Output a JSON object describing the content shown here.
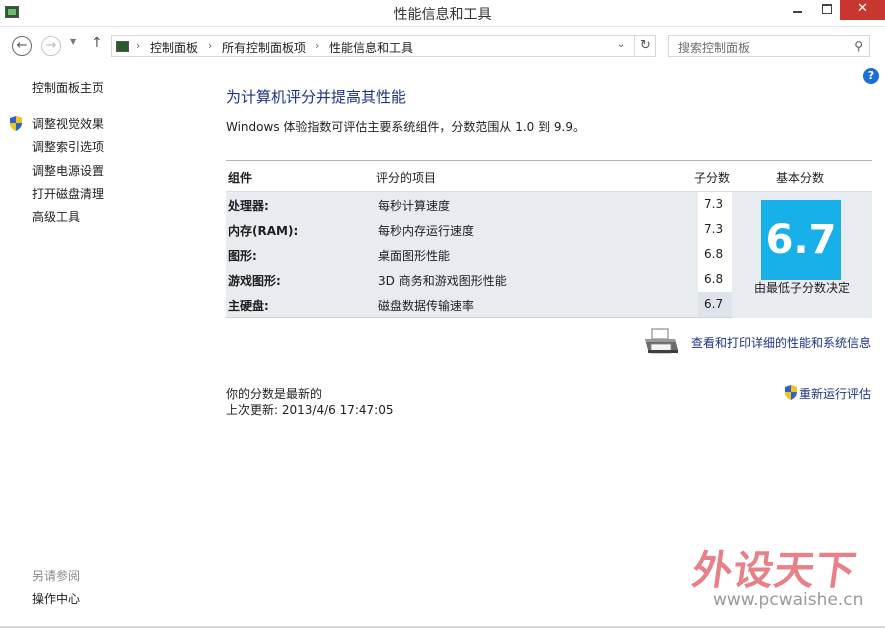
{
  "window": {
    "title": "性能信息和工具",
    "close_glyph": "✕"
  },
  "nav": {
    "back_glyph": "←",
    "forward_glyph": "→",
    "recent_glyph": "▼",
    "up_glyph": "↑",
    "breadcrumbs": [
      "控制面板",
      "所有控制面板项",
      "性能信息和工具"
    ],
    "separator": "›",
    "dropdown_glyph": "⌄",
    "refresh_glyph": "↻",
    "search_placeholder": "搜索控制面板",
    "search_glyph": "⚲"
  },
  "sidebar": {
    "home": "控制面板主页",
    "items": [
      "调整视觉效果",
      "调整索引选项",
      "调整电源设置",
      "打开磁盘清理",
      "高级工具"
    ],
    "see_also_label": "另请参阅",
    "see_also_items": [
      "操作中心"
    ]
  },
  "help_glyph": "?",
  "main": {
    "title": "为计算机评分并提高其性能",
    "description": "Windows 体验指数可评估主要系统组件，分数范围从 1.0 到 9.9。",
    "table": {
      "headers": {
        "component": "组件",
        "rated": "评分的项目",
        "subscore": "子分数",
        "base": "基本分数"
      },
      "rows": [
        {
          "component": "处理器:",
          "item": "每秒计算速度",
          "score": "7.3"
        },
        {
          "component": "内存(RAM):",
          "item": "每秒内存运行速度",
          "score": "7.3"
        },
        {
          "component": "图形:",
          "item": "桌面图形性能",
          "score": "6.8"
        },
        {
          "component": "游戏图形:",
          "item": "3D 商务和游戏图形性能",
          "score": "6.8"
        },
        {
          "component": "主硬盘:",
          "item": "磁盘数据传输速率",
          "score": "6.7"
        }
      ],
      "base_score": "6.7",
      "base_caption": "由最低子分数决定"
    },
    "print_link": "查看和打印详细的性能和系统信息",
    "status_line1": "你的分数是最新的",
    "status_line2": "上次更新: 2013/4/6 17:47:05",
    "rerun_link": "重新运行评估"
  },
  "watermark": {
    "logo_text": "外设天下",
    "url": "www.pcwaishe.cn"
  },
  "colors": {
    "accent_link": "#1e3287",
    "base_tile": "#18b0e8",
    "close_button": "#c7372f"
  }
}
